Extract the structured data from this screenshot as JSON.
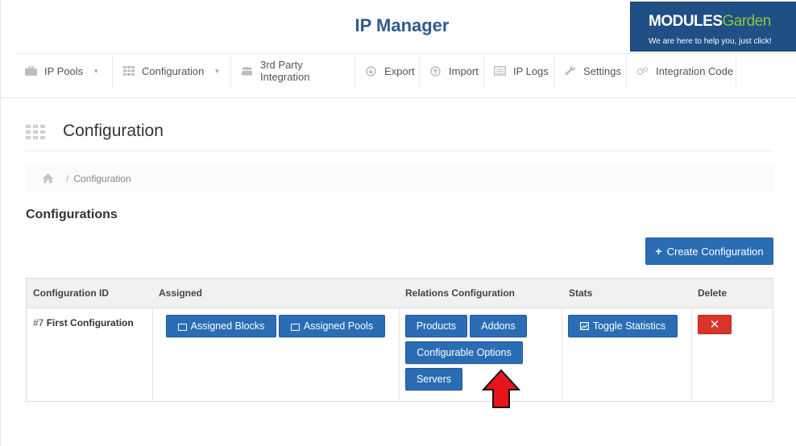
{
  "header": {
    "title": "IP Manager",
    "logo_brand_bold": "MODULES",
    "logo_brand_light": "Garden",
    "logo_tagline": "We are here to help you, just click!"
  },
  "nav": [
    {
      "label": "IP Pools",
      "icon": "briefcase-icon",
      "dropdown": true
    },
    {
      "label": "Configuration",
      "icon": "grid-icon",
      "dropdown": true
    },
    {
      "label": "3rd Party Integration",
      "icon": "users-icon",
      "dropdown": false
    },
    {
      "label": "Export",
      "icon": "download-icon",
      "dropdown": false
    },
    {
      "label": "Import",
      "icon": "upload-icon",
      "dropdown": false
    },
    {
      "label": "IP Logs",
      "icon": "list-icon",
      "dropdown": false
    },
    {
      "label": "Settings",
      "icon": "wrench-icon",
      "dropdown": false
    },
    {
      "label": "Integration Code",
      "icon": "gears-icon",
      "dropdown": false
    }
  ],
  "page": {
    "title": "Configuration",
    "breadcrumb_current": "Configuration",
    "breadcrumb_slash": "/",
    "section_heading": "Configurations",
    "create_button": "Create Configuration"
  },
  "table": {
    "headers": [
      "Configuration ID",
      "Assigned",
      "Relations Configuration",
      "Stats",
      "Delete"
    ],
    "rows": [
      {
        "id": "#7",
        "name": "First Configuration",
        "assigned_blocks": "Assigned Blocks",
        "assigned_pools": "Assigned Pools",
        "products": "Products",
        "addons": "Addons",
        "configurable_options": "Configurable Options",
        "servers": "Servers",
        "toggle_statistics": "Toggle Statistics"
      }
    ]
  },
  "colors": {
    "primary": "#2a6db5",
    "danger": "#d9342b",
    "title": "#2f5b8d",
    "arrow": "#e8141b"
  }
}
